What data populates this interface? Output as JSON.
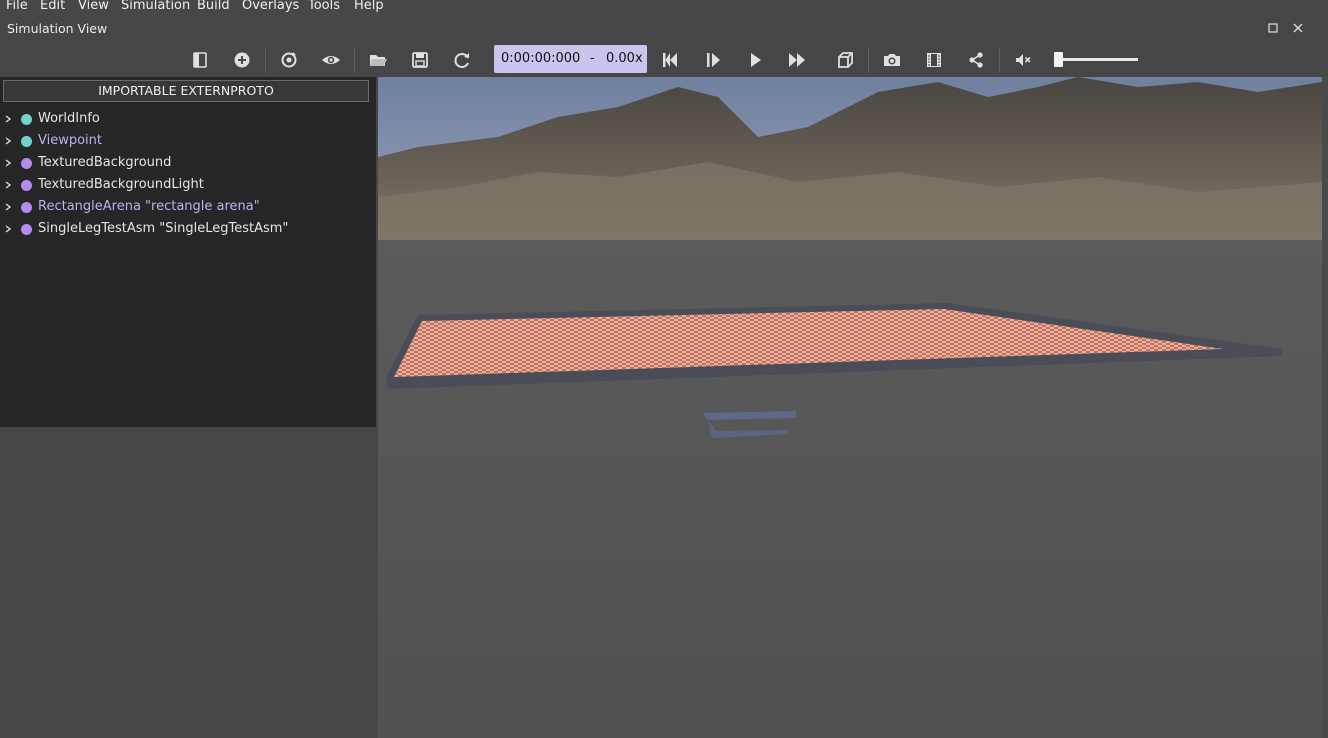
{
  "menu": [
    "File",
    "Edit",
    "View",
    "Simulation",
    "Build",
    "Overlays",
    "Tools",
    "Help"
  ],
  "window": {
    "title": "Simulation View"
  },
  "toolbar": {
    "time": "0:00:00:000",
    "separator": "-",
    "speed": "0.00x",
    "buttons": [
      "toggle-scene-tree",
      "add-node",
      "reset-view",
      "view-options",
      "open-world",
      "save-world",
      "reload-world",
      "reset-simulation",
      "step",
      "play",
      "fast",
      "follow-object",
      "screenshot",
      "record-movie",
      "share",
      "mute"
    ]
  },
  "scene_tree": {
    "externproto_label": "IMPORTABLE EXTERNPROTO",
    "nodes": [
      {
        "label": "WorldInfo",
        "dot_color": "#6fd4c9",
        "text_color": "#e6e6e6"
      },
      {
        "label": "Viewpoint",
        "dot_color": "#6fd4c9",
        "text_color": "#b9b4f2"
      },
      {
        "label": "TexturedBackground",
        "dot_color": "#b48cf0",
        "text_color": "#e6e6e6"
      },
      {
        "label": "TexturedBackgroundLight",
        "dot_color": "#b48cf0",
        "text_color": "#e6e6e6"
      },
      {
        "label": "RectangleArena \"rectangle arena\"",
        "dot_color": "#b48cf0",
        "text_color": "#b9b4f2"
      },
      {
        "label": "SingleLegTestAsm \"SingleLegTestAsm\"",
        "dot_color": "#b48cf0",
        "text_color": "#e6e6e6"
      }
    ]
  },
  "volume": {
    "level": 0.0
  }
}
